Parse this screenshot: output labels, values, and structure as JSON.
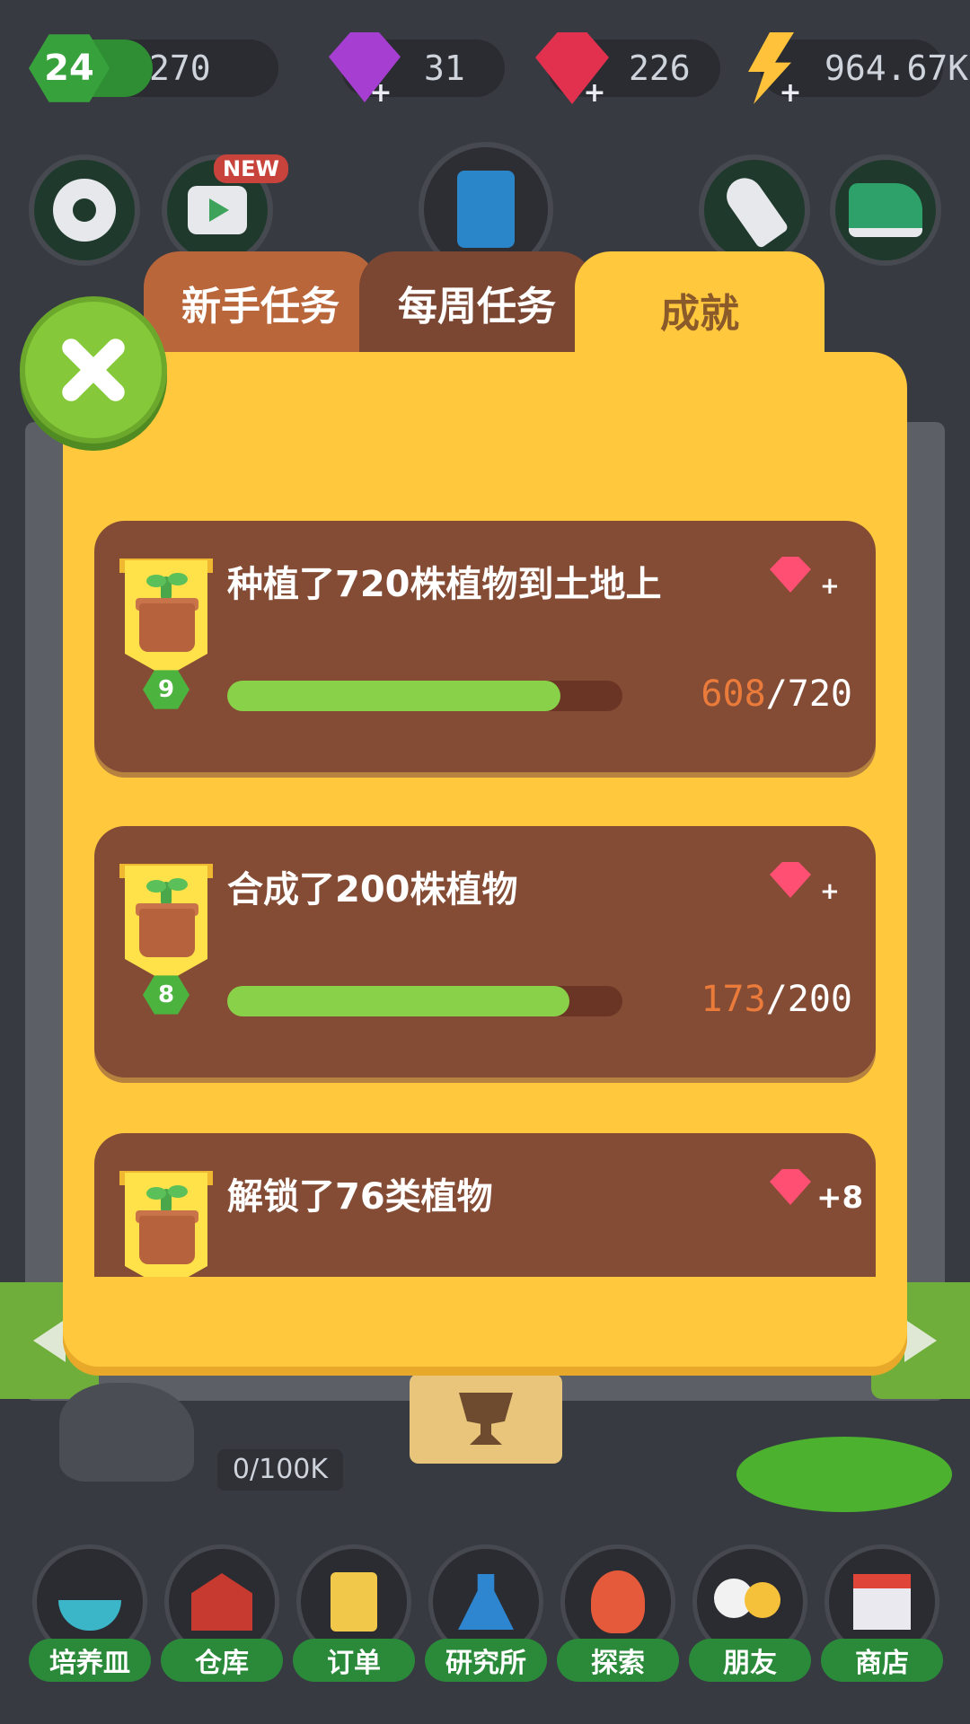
{
  "status_bar": {
    "level": "24",
    "xp": "270",
    "purple_gems": "31",
    "red_gems": "226",
    "energy": "964.67K"
  },
  "top_buttons": {
    "new_badge": "NEW"
  },
  "tabs": [
    {
      "label": "新手任务"
    },
    {
      "label": "每周任务"
    },
    {
      "label": "成就"
    }
  ],
  "achievements": [
    {
      "title": "种植了720株植物到土地上",
      "level": "9",
      "current": "608",
      "total": "/720",
      "progress": 0.844,
      "reward_plus": "+"
    },
    {
      "title": "合成了200株植物",
      "level": "8",
      "current": "173",
      "total": "/200",
      "progress": 0.865,
      "reward_plus": "+"
    },
    {
      "title": "解锁了76类植物",
      "reward_plus": "+8"
    }
  ],
  "world": {
    "counter": "0/100K"
  },
  "bottom_nav": [
    {
      "label": "培养皿"
    },
    {
      "label": "仓库"
    },
    {
      "label": "订单"
    },
    {
      "label": "研究所"
    },
    {
      "label": "探索"
    },
    {
      "label": "朋友"
    },
    {
      "label": "商店"
    }
  ],
  "colors": {
    "panel": "#ffc83d",
    "card": "#854c35",
    "progress_fill": "#8ad14a",
    "progress_current": "#ea7b3b"
  }
}
